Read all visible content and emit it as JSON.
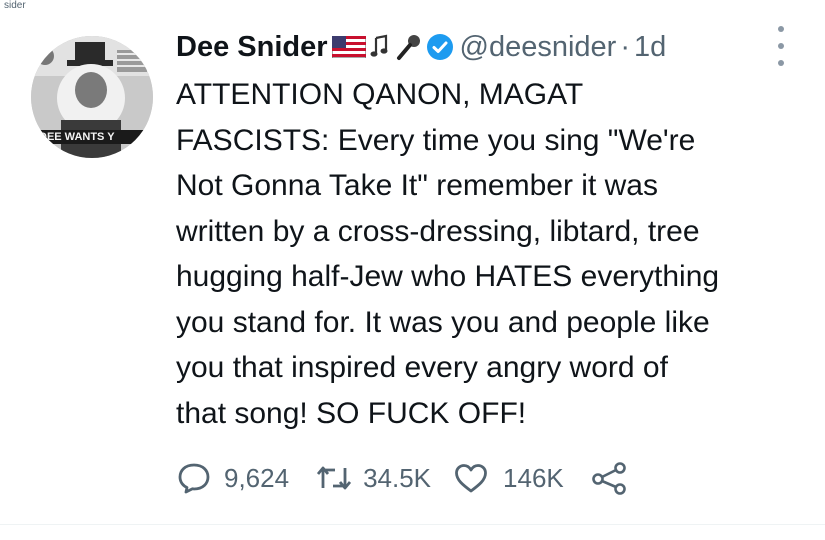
{
  "context": {
    "fragment": "sider"
  },
  "tweet": {
    "display_name": "Dee Snider",
    "handle": "@deesnider",
    "separator": "·",
    "timestamp": "1d",
    "badges": [
      "us-flag-icon",
      "music-notes-icon",
      "microphone-icon",
      "verified-badge-icon"
    ],
    "text": "ATTENTION QANON, MAGAT\nFASCISTS: Every time you sing \"We're\nNot Gonna Take It\" remember it was\nwritten by a cross-dressing, libtard, tree\nhugging half-Jew who HATES everything\nyou stand for. It was you and people like\nyou that inspired every angry word of\nthat song! SO FUCK OFF!",
    "avatar": {
      "caption": "DEE WANTS Y"
    },
    "stats": {
      "replies": "9,624",
      "retweets": "34.5K",
      "likes": "146K"
    }
  },
  "colors": {
    "text": "#0f1419",
    "secondary": "#536471",
    "verified": "#1d9bf0",
    "divider": "#eff3f4"
  }
}
